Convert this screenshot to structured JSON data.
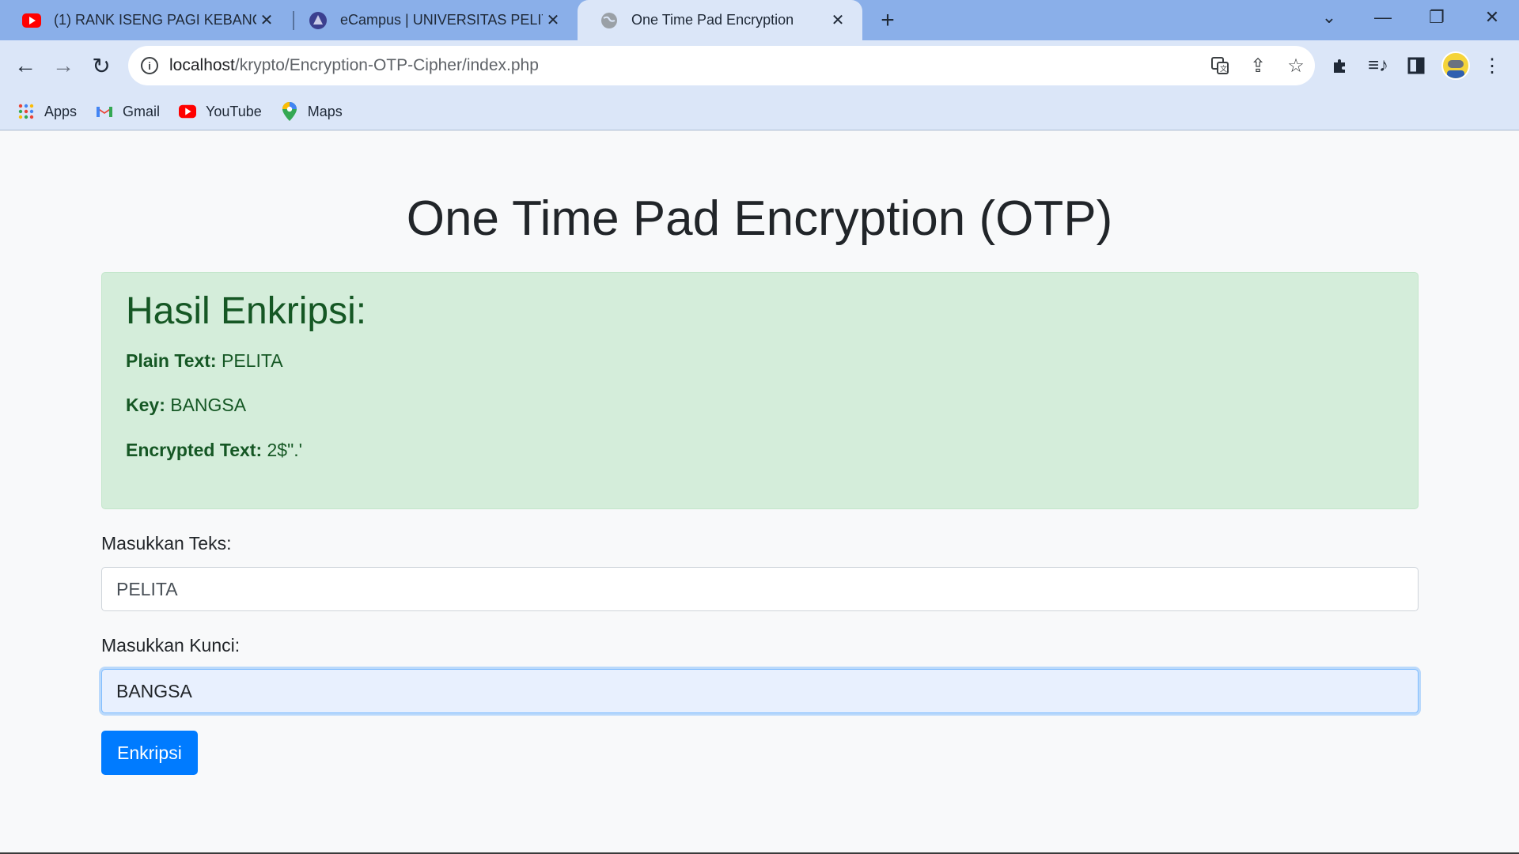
{
  "browser": {
    "tabs": [
      {
        "title": "(1) RANK ISENG PAGI KEBANGUN",
        "favicon": "youtube-icon"
      },
      {
        "title": "eCampus | UNIVERSITAS PELITA",
        "favicon": "ecampus-icon"
      },
      {
        "title": "One Time Pad Encryption",
        "favicon": "globe-icon"
      }
    ],
    "url_host": "localhost",
    "url_path": "/krypto/Encryption-OTP-Cipher/index.php",
    "bookmarks": [
      {
        "label": "Apps",
        "icon": "apps-grid-icon"
      },
      {
        "label": "Gmail",
        "icon": "gmail-icon"
      },
      {
        "label": "YouTube",
        "icon": "youtube-icon"
      },
      {
        "label": "Maps",
        "icon": "maps-icon"
      }
    ]
  },
  "page": {
    "title": "One Time Pad Encryption (OTP)",
    "result": {
      "heading": "Hasil Enkripsi:",
      "plain_label": "Plain Text:",
      "plain_value": "PELITA",
      "key_label": "Key:",
      "key_value": "BANGSA",
      "encrypted_label": "Encrypted Text:",
      "encrypted_value": "2$\".'"
    },
    "form": {
      "text_label": "Masukkan Teks:",
      "text_value": "PELITA",
      "key_label": "Masukkan Kunci:",
      "key_value": "BANGSA",
      "submit_label": "Enkripsi"
    }
  },
  "colors": {
    "tabstrip": "#8aafe9",
    "toolbar": "#dbe6f8",
    "alert_bg": "#d4edda",
    "alert_text": "#155724",
    "primary": "#007bff"
  }
}
